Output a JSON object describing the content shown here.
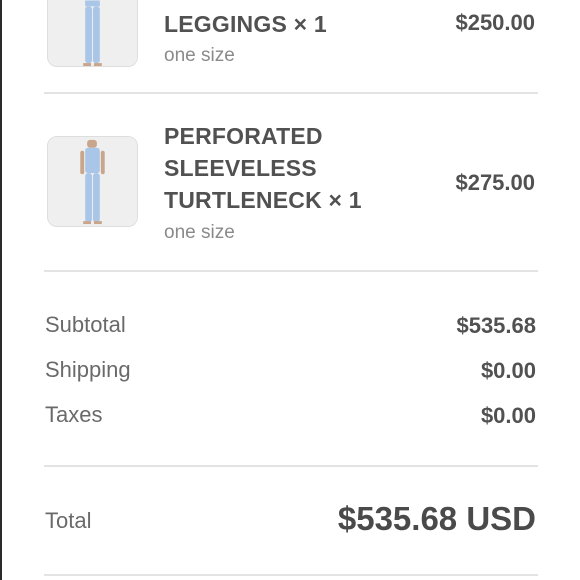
{
  "items": [
    {
      "name_lines": [
        "LEGGINGS"
      ],
      "quantity": "× 1",
      "variant": "one size",
      "price": "$250.00",
      "image": "model-leggings-thumbnail"
    },
    {
      "name_lines": [
        "PERFORATED",
        "SLEEVELESS",
        "TURTLENECK"
      ],
      "quantity": "× 1",
      "variant": "one size",
      "price": "$275.00",
      "image": "model-turtleneck-thumbnail"
    }
  ],
  "summary": {
    "subtotal_label": "Subtotal",
    "subtotal_value": "$535.68",
    "shipping_label": "Shipping",
    "shipping_value": "$0.00",
    "taxes_label": "Taxes",
    "taxes_value": "$0.00"
  },
  "total": {
    "label": "Total",
    "value": "$535.68 USD"
  },
  "colors": {
    "garment": "#a9c6e8",
    "skin": "#c9a58c",
    "text": "#515151",
    "muted": "#8a8a8a",
    "divider": "#e3e3e3"
  }
}
